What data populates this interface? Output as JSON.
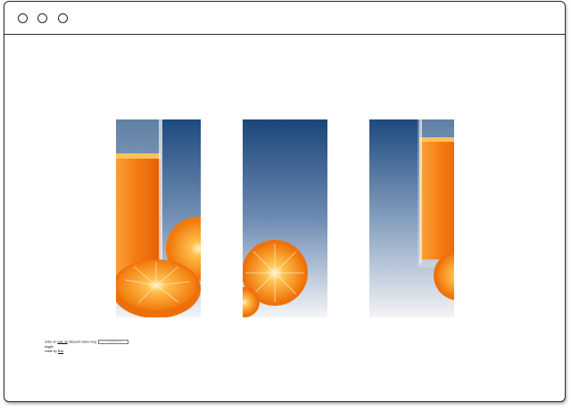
{
  "window": {
    "controls": [
      "close",
      "minimize",
      "maximize"
    ]
  },
  "gallery": {
    "panels": [
      {
        "name": "orange-juice-glass-left",
        "subject": "glass of orange juice with orange halves"
      },
      {
        "name": "orange-half-center",
        "subject": "orange halves on gradient background"
      },
      {
        "name": "orange-juice-glass-right",
        "subject": "glass of orange juice with orange half"
      }
    ]
  },
  "caption": {
    "line1_prefix": "order on",
    "line1_link": "sale ok",
    "line1_middle": "discount name mug",
    "input_placeholder": "e.g. orange@domain",
    "line2": "toggle",
    "line3_prefix": "made by",
    "line3_link": "Bob"
  },
  "colors": {
    "sky_top": "#1d4a7e",
    "sky_bottom": "#eef1f5",
    "orange": "#f47a12",
    "orange_light": "#ffb347",
    "border": "#2b2b2b"
  }
}
